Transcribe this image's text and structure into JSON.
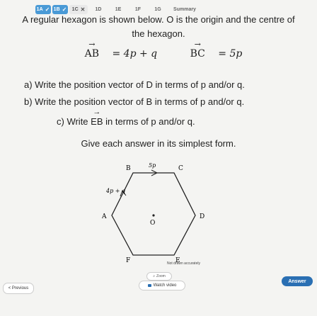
{
  "tabs": [
    {
      "label": "1A",
      "state": "done",
      "mark": "✓"
    },
    {
      "label": "1B",
      "state": "done",
      "mark": "✓"
    },
    {
      "label": "1C",
      "state": "wrong",
      "mark": "✕"
    },
    {
      "label": "1D",
      "state": "plain",
      "mark": ""
    },
    {
      "label": "1E",
      "state": "plain",
      "mark": ""
    },
    {
      "label": "1F",
      "state": "plain",
      "mark": ""
    },
    {
      "label": "1G",
      "state": "plain",
      "mark": ""
    },
    {
      "label": "Summary",
      "state": "plain",
      "mark": ""
    }
  ],
  "question": {
    "line1": "A regular hexagon is shown below. O is the origin and the centre of",
    "line2": "the hexagon.",
    "eq1_lhs": "AB",
    "eq1_rhs": " = 4p + q",
    "eq2_lhs": "BC",
    "eq2_rhs": " = 5p",
    "part_a": "a) Write the position vector of D in terms of p and/or q.",
    "part_b": "b) Write the position vector of B in terms of p and/or q.",
    "part_c_pre": "c) Write ",
    "part_c_vec": "EB",
    "part_c_post": " in terms of p and/or q.",
    "simplest": "Give each answer in its simplest form."
  },
  "diagram": {
    "labels": {
      "A": "A",
      "B": "B",
      "C": "C",
      "D": "D",
      "E": "E",
      "F": "F",
      "O": "O"
    },
    "edge_bc": "5p",
    "edge_ab": "4p + q",
    "note": "Not drawn accurately"
  },
  "controls": {
    "zoom": "Zoom",
    "previous": "< Previous",
    "watch_video": "Watch video",
    "answer": "Answer"
  },
  "colors": {
    "accent": "#2a6fb3",
    "tab_done": "#4a9ad6"
  }
}
